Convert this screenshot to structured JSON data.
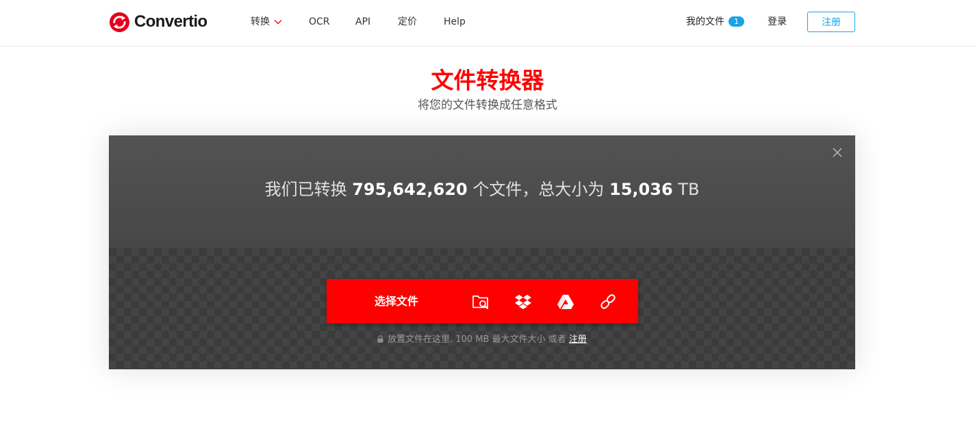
{
  "header": {
    "logo_text": "Convertio",
    "nav": [
      {
        "label": "转换",
        "has_dropdown": true
      },
      {
        "label": "OCR"
      },
      {
        "label": "API"
      },
      {
        "label": "定价"
      },
      {
        "label": "Help"
      }
    ],
    "my_files_label": "我的文件",
    "my_files_count": "1",
    "login_label": "登录",
    "register_label": "注册"
  },
  "hero": {
    "title": "文件转换器",
    "subtitle": "将您的文件转换成任意格式"
  },
  "panel": {
    "stats_prefix": "我们已转换",
    "files_count": "795,642,620",
    "stats_mid": "个文件，总大小为",
    "total_size": "15,036",
    "size_unit": "TB",
    "choose_files_label": "选择文件",
    "sources": [
      "folder-search-icon",
      "dropbox-icon",
      "google-drive-icon",
      "link-icon"
    ],
    "hint_text": "放置文件在这里. 100 MB 最大文件大小 或者",
    "hint_link": "注册"
  },
  "colors": {
    "brand_red": "#ff0000",
    "accent_blue": "#1ba2e8",
    "panel_dark": "#4a4a4a"
  }
}
